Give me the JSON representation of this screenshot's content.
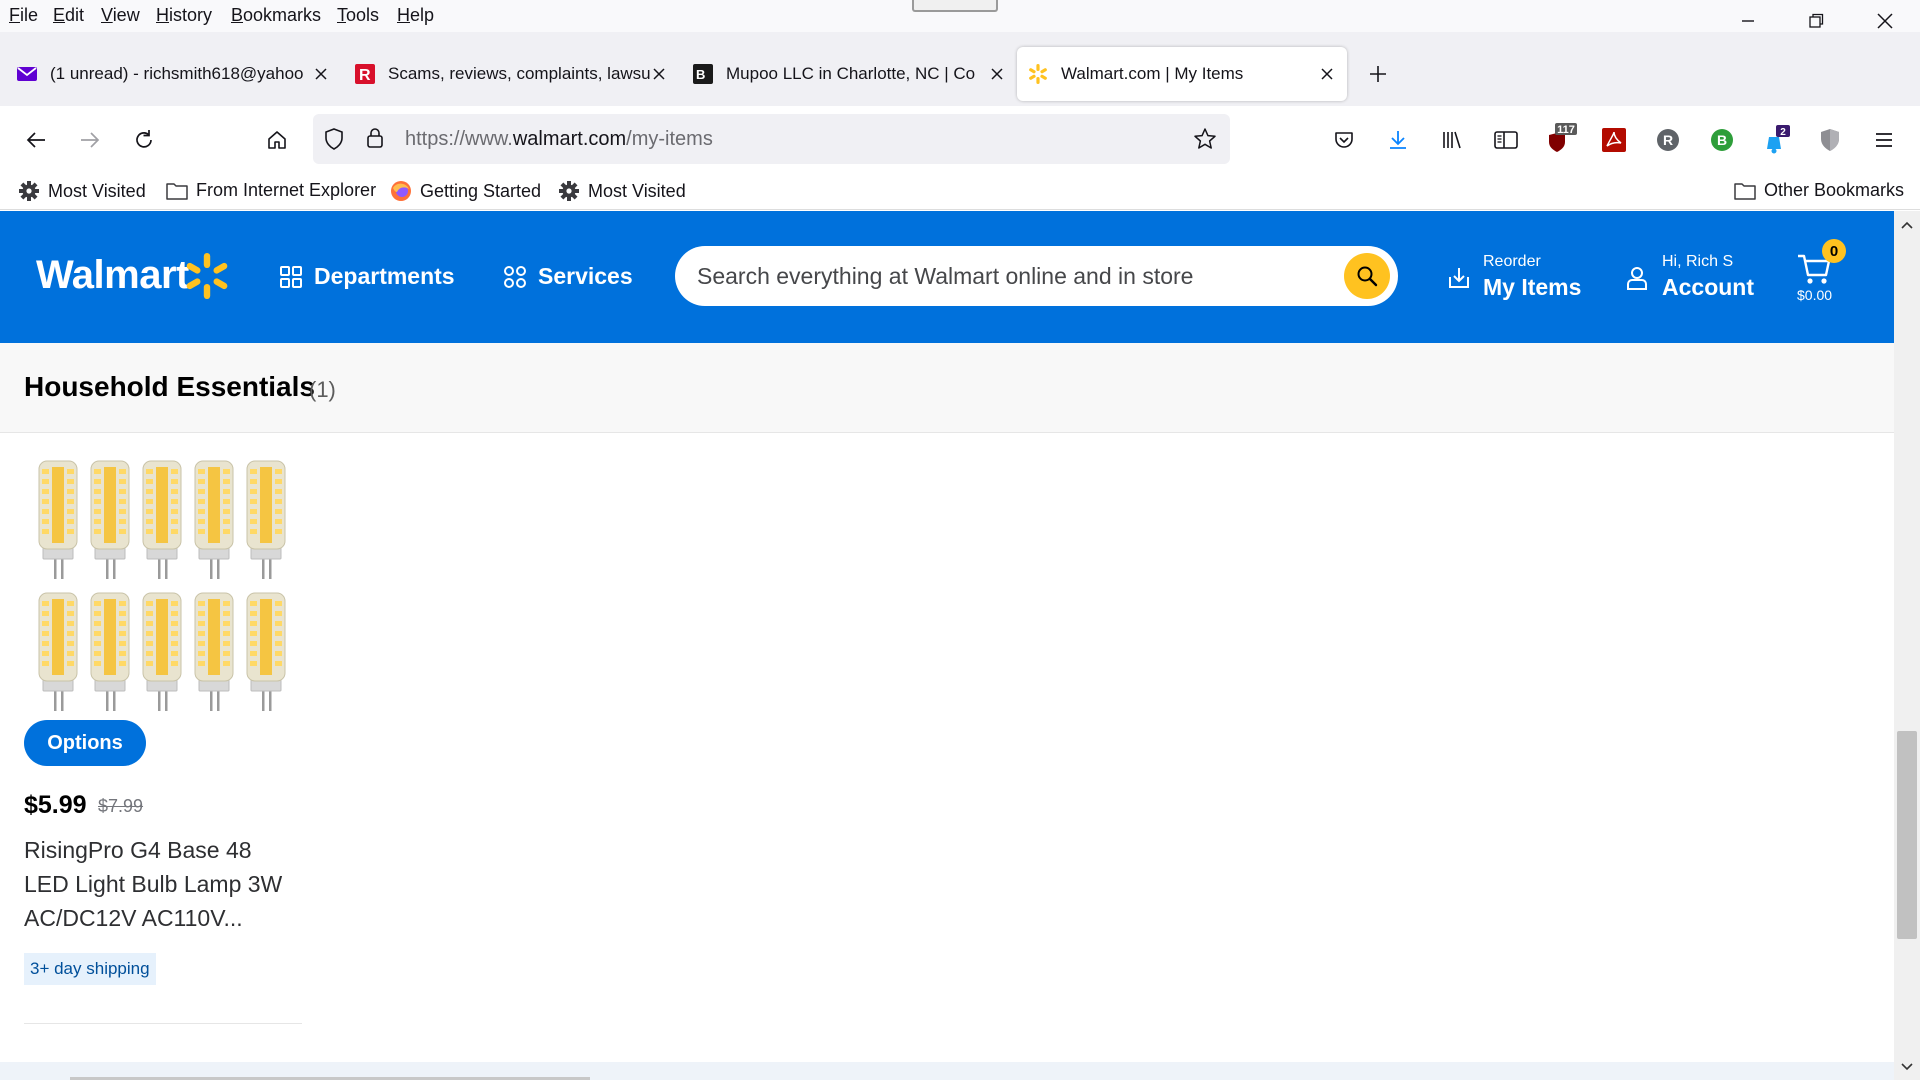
{
  "browser": {
    "menu": [
      "File",
      "Edit",
      "View",
      "History",
      "Bookmarks",
      "Tools",
      "Help"
    ],
    "tabs": [
      {
        "title": "(1 unread) - richsmith618@yahoo",
        "icon": "mail-icon",
        "active": false
      },
      {
        "title": "Scams, reviews, complaints, lawsuits",
        "icon": "ripoff-report-icon",
        "active": false
      },
      {
        "title": "Mupoo LLC in Charlotte, NC | Co",
        "icon": "bbb-icon",
        "active": false
      },
      {
        "title": "Walmart.com | My Items",
        "icon": "walmart-spark-icon",
        "active": true
      }
    ],
    "url": {
      "prefix": "https://www.",
      "domain": "walmart.com",
      "path": "/my-items"
    },
    "badges": {
      "ublock": "117",
      "notifications": "2",
      "r_avatar": "R",
      "b_avatar": "B"
    },
    "bookmarks": [
      "Most Visited",
      "From Internet Explorer",
      "Getting Started",
      "Most Visited"
    ],
    "other_bookmarks": "Other Bookmarks"
  },
  "walmart": {
    "logo": "Walmart",
    "nav": {
      "departments": "Departments",
      "services": "Services"
    },
    "search_placeholder": "Search everything at Walmart online and in store",
    "reorder": {
      "small": "Reorder",
      "big": "My Items"
    },
    "account": {
      "small": "Hi, Rich S",
      "big": "Account"
    },
    "cart": {
      "count": "0",
      "total": "$0.00"
    },
    "colors": {
      "brand_blue": "#0071dc",
      "spark_yellow": "#ffc220"
    }
  },
  "section": {
    "title": "Household Essentials",
    "count": "(1)"
  },
  "product": {
    "options_label": "Options",
    "price": "$5.99",
    "was_price": "$7.99",
    "title": "RisingPro G4 Base 48 LED Light Bulb Lamp 3W AC/DC12V AC110V...",
    "shipping": "3+ day shipping"
  }
}
